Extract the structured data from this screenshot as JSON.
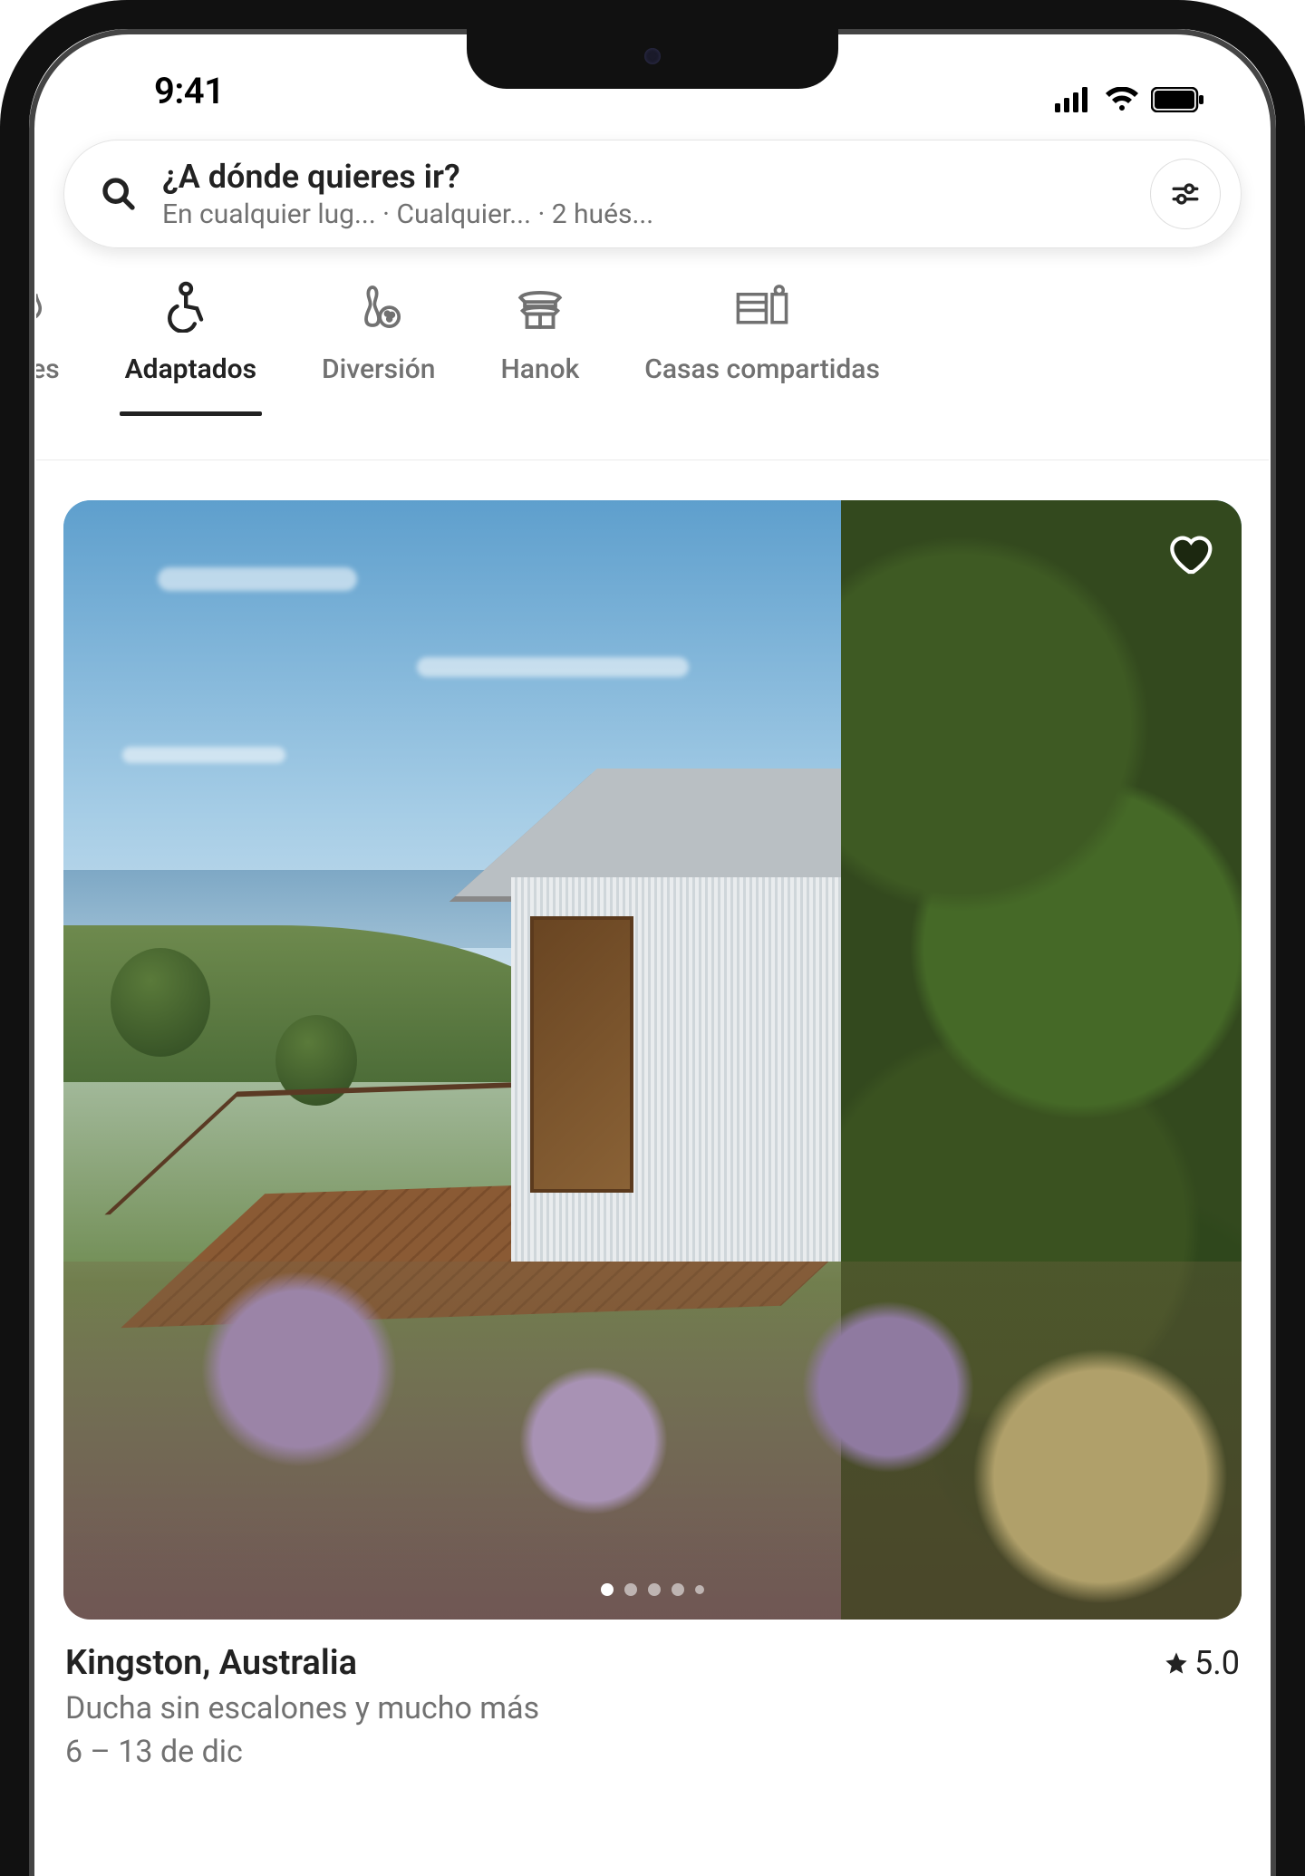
{
  "status": {
    "time": "9:41"
  },
  "search": {
    "title": "¿A dónde quieres ir?",
    "subtitle": "En cualquier lug... · Cualquier... · 2 hués..."
  },
  "categories": [
    {
      "id": "lares",
      "label": "lares",
      "icon": "flame",
      "active": false
    },
    {
      "id": "adaptados",
      "label": "Adaptados",
      "icon": "wheelchair",
      "active": true
    },
    {
      "id": "diversion",
      "label": "Diversión",
      "icon": "bowling",
      "active": false
    },
    {
      "id": "hanok",
      "label": "Hanok",
      "icon": "hanok",
      "active": false
    },
    {
      "id": "compartidas",
      "label": "Casas compartidas",
      "icon": "rooms",
      "active": false
    }
  ],
  "listing": {
    "location": "Kingston, Australia",
    "rating": "5.0",
    "feature": "Ducha sin escalones y mucho más",
    "dates": "6 – 13 de dic",
    "carousel": {
      "count": 5,
      "current": 0
    }
  }
}
